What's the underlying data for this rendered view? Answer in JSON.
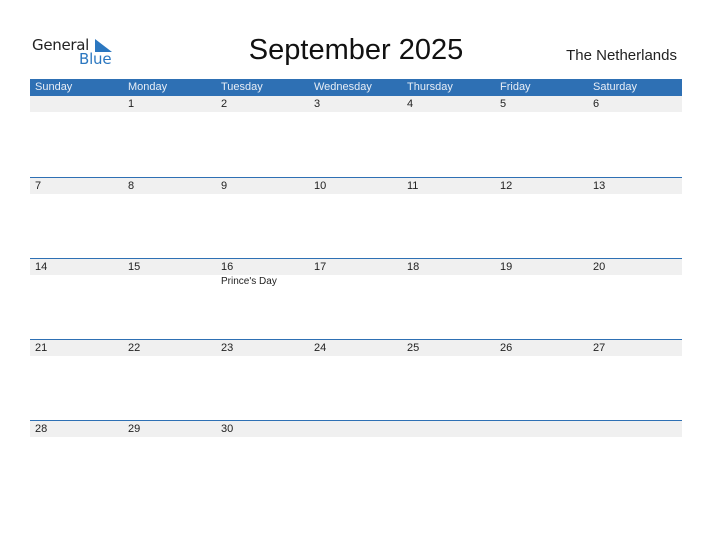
{
  "header": {
    "logo_general": "General",
    "logo_blue": "Blue",
    "title": "September 2025",
    "country": "The Netherlands"
  },
  "colors": {
    "accent": "#2e70b4",
    "logo_blue": "#2b77c0",
    "band": "#f0f0f0"
  },
  "weekdays": [
    "Sunday",
    "Monday",
    "Tuesday",
    "Wednesday",
    "Thursday",
    "Friday",
    "Saturday"
  ],
  "weeks": [
    [
      "",
      "1",
      "2",
      "3",
      "4",
      "5",
      "6"
    ],
    [
      "7",
      "8",
      "9",
      "10",
      "11",
      "12",
      "13"
    ],
    [
      "14",
      "15",
      "16",
      "17",
      "18",
      "19",
      "20"
    ],
    [
      "21",
      "22",
      "23",
      "24",
      "25",
      "26",
      "27"
    ],
    [
      "28",
      "29",
      "30",
      "",
      "",
      "",
      ""
    ]
  ],
  "holidays": [
    {
      "date": "16",
      "name": "Prince's Day"
    }
  ]
}
